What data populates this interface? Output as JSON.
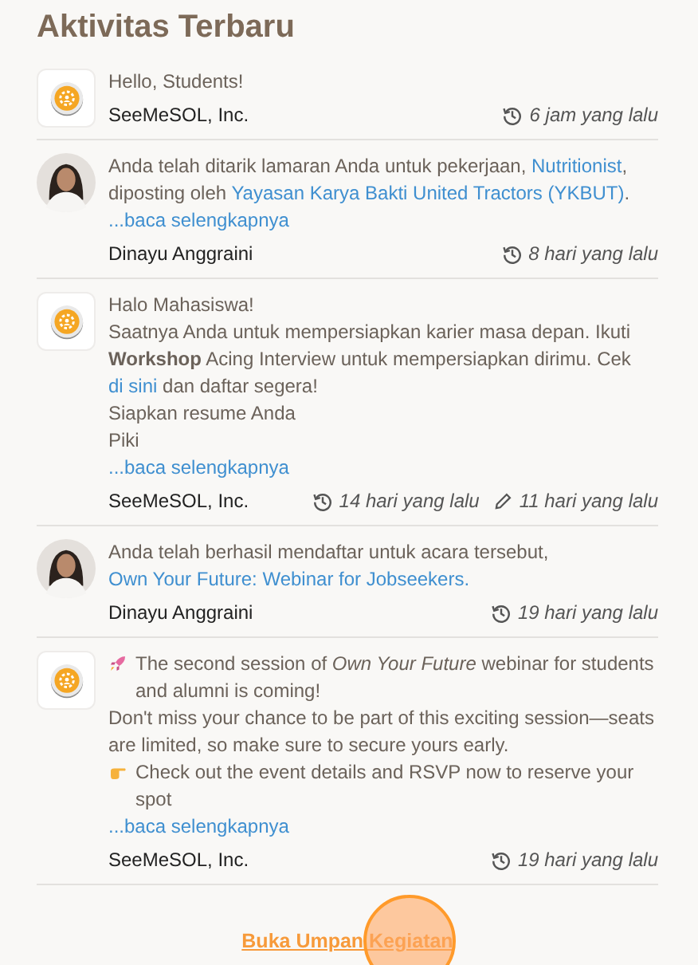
{
  "title": "Aktivitas Terbaru",
  "items": [
    {
      "kind": "company",
      "lines": [
        {
          "segments": [
            {
              "kind": "text",
              "text": "Hello, Students!"
            }
          ]
        }
      ],
      "author": "SeeMeSOL, Inc.",
      "times": [
        {
          "kind": "created",
          "text": "6 jam yang lalu"
        }
      ]
    },
    {
      "kind": "person",
      "lines": [
        {
          "segments": [
            {
              "kind": "text",
              "text": "Anda telah ditarik lamaran Anda untuk pekerjaan, "
            },
            {
              "kind": "link",
              "text": "Nutritionist"
            },
            {
              "kind": "text",
              "text": ", diposting oleh "
            },
            {
              "kind": "link",
              "text": "Yayasan Karya Bakti United Tractors (YKBUT)"
            },
            {
              "kind": "text",
              "text": "."
            }
          ]
        }
      ],
      "read_more": "...baca selengkapnya",
      "author": "Dinayu Anggraini",
      "times": [
        {
          "kind": "created",
          "text": "8 hari yang lalu"
        }
      ]
    },
    {
      "kind": "company",
      "lines": [
        {
          "segments": [
            {
              "kind": "text",
              "text": "Halo Mahasiswa!"
            }
          ]
        },
        {
          "segments": [
            {
              "kind": "text",
              "text": "Saatnya Anda untuk mempersiapkan karier masa depan. Ikuti **Workshop** Acing Interview untuk mempersiapkan dirimu. Cek "
            },
            {
              "kind": "link",
              "text": "di sini"
            },
            {
              "kind": "text",
              "text": " dan daftar segera!"
            }
          ]
        },
        {
          "segments": [
            {
              "kind": "text",
              "text": "Siapkan resume Anda"
            }
          ]
        },
        {
          "segments": [
            {
              "kind": "text",
              "text": "Piki"
            }
          ]
        }
      ],
      "read_more": "...baca selengkapnya",
      "author": "SeeMeSOL, Inc.",
      "times": [
        {
          "kind": "created",
          "text": "14 hari yang lalu"
        },
        {
          "kind": "edited",
          "text": "11 hari yang lalu"
        }
      ]
    },
    {
      "kind": "person",
      "lines": [
        {
          "segments": [
            {
              "kind": "text",
              "text": "Anda telah berhasil mendaftar untuk acara tersebut, "
            },
            {
              "kind": "link",
              "text": "Own Your Future: Webinar for Jobseekers."
            }
          ]
        }
      ],
      "author": "Dinayu Anggraini",
      "times": [
        {
          "kind": "created",
          "text": "19 hari yang lalu"
        }
      ]
    },
    {
      "kind": "company",
      "lines": [
        {
          "kind": "rocket",
          "segments": [
            {
              "kind": "text",
              "text": "The second session of *Own Your Future* webinar for students and alumni is coming!"
            }
          ]
        },
        {
          "segments": [
            {
              "kind": "text",
              "text": "Don't miss your chance to be part of this exciting session—seats are limited, so make sure to secure yours early."
            }
          ]
        },
        {
          "kind": "hand",
          "segments": [
            {
              "kind": "text",
              "text": "Check out the event details and RSVP now to reserve your spot"
            }
          ]
        }
      ],
      "read_more": "...baca selengkapnya",
      "author": "SeeMeSOL, Inc.",
      "times": [
        {
          "kind": "created",
          "text": "19 hari yang lalu"
        }
      ]
    }
  ],
  "footer_link": "Buka Umpan Kegiatan",
  "touch_indicator": true
}
